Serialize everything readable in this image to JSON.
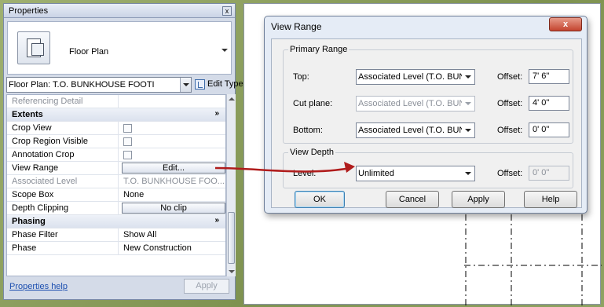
{
  "properties": {
    "title": "Properties",
    "close_glyph": "x",
    "type_name": "Floor Plan",
    "instance_selector": "Floor Plan: T.O. BUNKHOUSE FOOTI",
    "edit_type_label": "Edit Type",
    "rows": [
      {
        "key": "Referencing Detail",
        "value": "",
        "kind": "dim"
      },
      {
        "key": "Extents",
        "value": "",
        "kind": "group",
        "chevron": "»"
      },
      {
        "key": "Crop View",
        "value": "",
        "kind": "check"
      },
      {
        "key": "Crop Region Visible",
        "value": "",
        "kind": "check"
      },
      {
        "key": "Annotation Crop",
        "value": "",
        "kind": "check"
      },
      {
        "key": "View Range",
        "value": "Edit...",
        "kind": "button"
      },
      {
        "key": "Associated Level",
        "value": "T.O. BUNKHOUSE FOO...",
        "kind": "dim"
      },
      {
        "key": "Scope Box",
        "value": "None",
        "kind": "text"
      },
      {
        "key": "Depth Clipping",
        "value": "No clip",
        "kind": "button"
      },
      {
        "key": "Phasing",
        "value": "",
        "kind": "group",
        "chevron": "»"
      },
      {
        "key": "Phase Filter",
        "value": "Show All",
        "kind": "text"
      },
      {
        "key": "Phase",
        "value": "New Construction",
        "kind": "text"
      }
    ],
    "help_link": "Properties help",
    "apply_label": "Apply"
  },
  "dialog": {
    "title": "View Range",
    "close_glyph": "x",
    "primary_range": {
      "label": "Primary Range",
      "top_label": "Top:",
      "top_value": "Associated Level (T.O. BUN",
      "top_offset": "7' 6\"",
      "cut_label": "Cut plane:",
      "cut_value": "Associated Level (T.O. BUN",
      "cut_offset": "4' 0\"",
      "bottom_label": "Bottom:",
      "bottom_value": "Associated Level (T.O. BUN",
      "bottom_offset": "0' 0\""
    },
    "offset_label": "Offset:",
    "view_depth": {
      "label": "View Depth",
      "level_label": "Level:",
      "level_value": "Unlimited",
      "offset": "0' 0\""
    },
    "buttons": {
      "ok": "OK",
      "cancel": "Cancel",
      "apply": "Apply",
      "help": "Help"
    }
  },
  "colors": {
    "arrow": "#b01c1c",
    "accent": "#3c7fb1"
  }
}
